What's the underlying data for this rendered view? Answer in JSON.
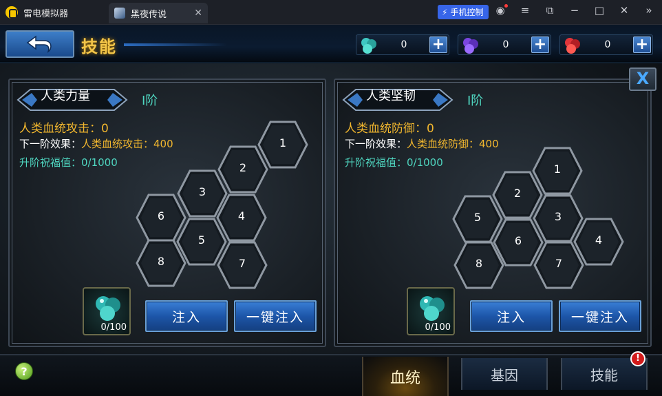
{
  "emulator": {
    "app_name": "雷电模拟器",
    "game_tab": "黑夜传说",
    "tab_close": "✕",
    "phone_control": "手机控制"
  },
  "header": {
    "title": "技能",
    "currencies": [
      {
        "value": "0",
        "gem_color": "#3fc7c2"
      },
      {
        "value": "0",
        "gem_color": "#7a46e0"
      },
      {
        "value": "0",
        "gem_color": "#e0353a"
      }
    ],
    "plus": "+"
  },
  "close": "X",
  "panels": [
    {
      "badge": "人类力量",
      "tier": "I阶",
      "stat": "人类血统攻击：0",
      "effect_prefix": "下一阶效果：",
      "effect_value": "人类血统攻击：400",
      "bless": "升阶祝福值：0/1000",
      "nodes": [
        "1",
        "2",
        "3",
        "4",
        "5",
        "6",
        "7",
        "8"
      ],
      "item_count": "0/100",
      "inject": "注入",
      "inject_all": "一键注入"
    },
    {
      "badge": "人类坚韧",
      "tier": "I阶",
      "stat": "人类血统防御：0",
      "effect_prefix": "下一阶效果：",
      "effect_value": "人类血统防御：400",
      "bless": "升阶祝福值：0/1000",
      "nodes": [
        "1",
        "2",
        "3",
        "4",
        "5",
        "6",
        "7",
        "8"
      ],
      "item_count": "0/100",
      "inject": "注入",
      "inject_all": "一键注入"
    }
  ],
  "bottom": {
    "help": "?",
    "tabs": [
      "血统",
      "基因",
      "技能"
    ],
    "alert": "!"
  }
}
